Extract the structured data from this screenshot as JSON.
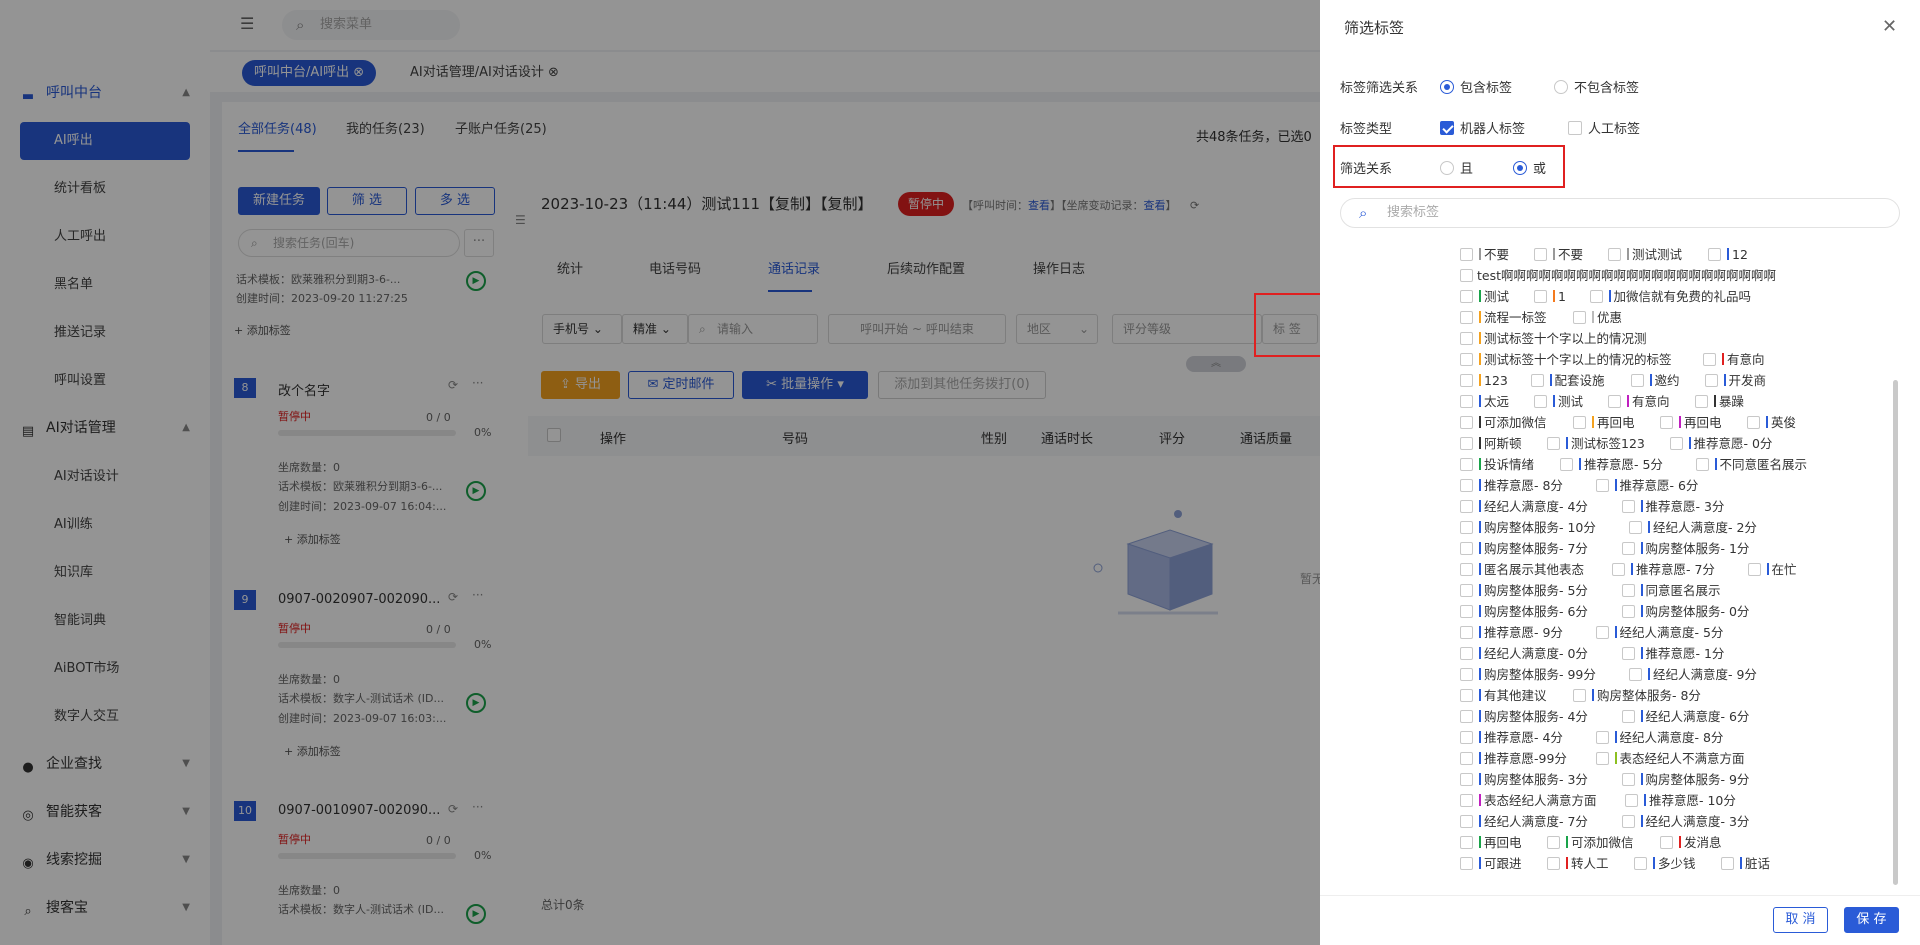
{
  "topbar": {
    "search_placeholder": "搜索菜单"
  },
  "open_tabs": [
    {
      "label": "呼叫中台/AI呼出"
    },
    {
      "label": "AI对话管理/AI对话设计"
    }
  ],
  "sidebar": {
    "sections": [
      {
        "label": "呼叫中台",
        "icon": "monitor-icon"
      },
      {
        "label": "AI对话管理",
        "icon": "dialog-icon"
      },
      {
        "label": "企业查找",
        "icon": "bulb-icon"
      },
      {
        "label": "智能获客",
        "icon": "magnifier-icon"
      },
      {
        "label": "线索挖掘",
        "icon": "target-icon"
      },
      {
        "label": "搜客宝",
        "icon": "search-icon"
      }
    ],
    "call_items": [
      {
        "label": "AI呼出"
      },
      {
        "label": "统计看板"
      },
      {
        "label": "人工呼出"
      },
      {
        "label": "黑名单"
      },
      {
        "label": "推送记录"
      },
      {
        "label": "呼叫设置"
      }
    ],
    "ai_items": [
      {
        "label": "AI对话设计"
      },
      {
        "label": "AI训练"
      },
      {
        "label": "知识库"
      },
      {
        "label": "智能词典"
      },
      {
        "label": "AiBOT市场"
      },
      {
        "label": "数字人交互"
      }
    ]
  },
  "main": {
    "task_tabs": [
      {
        "label": "全部任务(48)"
      },
      {
        "label": "我的任务(23)"
      },
      {
        "label": "子账户任务(25)"
      }
    ],
    "summary": "共48条任务，已选0",
    "buttons": {
      "new_task": "新建任务",
      "filter": "筛 选",
      "multi": "多 选"
    },
    "task_search_placeholder": "搜索任务(回车)",
    "more": "···",
    "task_top": {
      "template": "话术模板：欧莱雅积分到期3-6-...",
      "created": "创建时间：2023-09-20 11:27:25",
      "add_tag": "+ 添加标签"
    },
    "tasks": [
      {
        "num": "8",
        "name": "改个名字",
        "status": "暂停中",
        "count": "0 / 0",
        "pct": "0%",
        "seats": "坐席数量：0",
        "template": "话术模板：欧莱雅积分到期3-6-...",
        "created": "创建时间：2023-09-07 16:04:...",
        "add_tag": "+ 添加标签"
      },
      {
        "num": "9",
        "name": "0907-0020907-002090...",
        "status": "暂停中",
        "count": "0 / 0",
        "pct": "0%",
        "seats": "坐席数量：0",
        "template": "话术模板：数字人-测试话术 (ID...",
        "created": "创建时间：2023-09-07 16:03:...",
        "add_tag": "+ 添加标签"
      },
      {
        "num": "10",
        "name": "0907-0010907-002090...",
        "status": "暂停中",
        "count": "0 / 0",
        "pct": "0%",
        "seats": "坐席数量：0",
        "template": "话术模板：数字人-测试话术 (ID..."
      }
    ],
    "detail": {
      "title": "2023-10-23（11:44）测试111【复制】【复制】",
      "status": "暂停中",
      "call_time_label": "【呼叫时间：",
      "view1": "查看",
      "seat_log_label": "】【坐席变动记录：",
      "view2": "查看",
      "close_bracket": "】",
      "tabs": [
        {
          "label": "统计"
        },
        {
          "label": "电话号码"
        },
        {
          "label": "通话记录"
        },
        {
          "label": "后续动作配置"
        },
        {
          "label": "操作日志"
        }
      ],
      "filters": {
        "phone": "手机号",
        "exact": "精准",
        "input_placeholder": "请输入",
        "call_range": "呼叫开始 ~ 呼叫结束",
        "region": "地区",
        "score": "评分等级",
        "tag": "标 签"
      },
      "actions": {
        "export": "导出",
        "email": "定时邮件",
        "batch": "批量操作",
        "dial_other": "添加到其他任务拨打(0)"
      },
      "columns": [
        {
          "label": "操作"
        },
        {
          "label": "号码"
        },
        {
          "label": "性别"
        },
        {
          "label": "通话时长"
        },
        {
          "label": "评分"
        },
        {
          "label": "通话质量"
        }
      ],
      "empty_text": "暂无",
      "total": "总计0条"
    }
  },
  "drawer": {
    "title": "筛选标签",
    "row1": {
      "label": "标签筛选关系",
      "opt1": "包含标签",
      "opt2": "不包含标签"
    },
    "row2": {
      "label": "标签类型",
      "opt1": "机器人标签",
      "opt2": "人工标签"
    },
    "row3": {
      "label": "筛选关系",
      "opt1": "且",
      "opt2": "或"
    },
    "search_placeholder": "搜索标签",
    "cancel": "取 消",
    "save": "保 存",
    "tags": [
      [
        {
          "t": "不要",
          "c": "#999999"
        },
        {
          "t": "不要",
          "c": "#999999"
        },
        {
          "t": "测试测试",
          "c": "#999999"
        },
        {
          "t": "12",
          "c": "#2a5bd7"
        }
      ],
      [
        {
          "t": "test啊啊啊啊啊啊啊啊啊啊啊啊啊啊啊啊啊啊啊啊啊啊",
          "c": ""
        }
      ],
      [
        {
          "t": "测试",
          "c": "#1aa34a"
        },
        {
          "t": "1",
          "c": "#f47a1f"
        },
        {
          "t": "加微信就有免费的礼品吗",
          "c": "#2a5bd7"
        }
      ],
      [
        {
          "t": "流程一标签",
          "c": "#f4a21f"
        },
        {
          "t": "优惠",
          "c": "#bbbbbb"
        }
      ],
      [
        {
          "t": "测试标签十个字以上的情况测",
          "c": "#f4a21f"
        }
      ],
      [
        {
          "t": "测试标签十个字以上的情况的标签",
          "c": "#f4a21f"
        },
        {
          "t": "有意向",
          "c": "#e02020"
        }
      ],
      [
        {
          "t": "123",
          "c": "#f4a21f"
        },
        {
          "t": "配套设施",
          "c": "#2a5bd7"
        },
        {
          "t": "邀约",
          "c": "#2a5bd7"
        },
        {
          "t": "开发商",
          "c": "#2a5bd7"
        }
      ],
      [
        {
          "t": "太远",
          "c": "#2a5bd7"
        },
        {
          "t": "测试",
          "c": "#2a5bd7"
        },
        {
          "t": "有意向",
          "c": "#c020c0"
        },
        {
          "t": "暴躁",
          "c": "#333333"
        }
      ],
      [
        {
          "t": "可添加微信",
          "c": "#333333"
        },
        {
          "t": "再回电",
          "c": "#f4a21f"
        },
        {
          "t": "再回电",
          "c": "#c020c0"
        },
        {
          "t": "英俊",
          "c": "#2a5bd7"
        }
      ],
      [
        {
          "t": "阿斯顿",
          "c": "#333333"
        },
        {
          "t": "测试标签123",
          "c": "#2a5bd7"
        },
        {
          "t": "推荐意愿- 0分",
          "c": "#2a5bd7"
        }
      ],
      [
        {
          "t": "投诉情绪",
          "c": "#1aa34a"
        },
        {
          "t": "推荐意愿- 5分",
          "c": "#2a5bd7"
        },
        {
          "t": "不同意匿名展示",
          "c": "#2a5bd7"
        }
      ],
      [
        {
          "t": "推荐意愿- 8分",
          "c": "#2a5bd7"
        },
        {
          "t": "推荐意愿- 6分",
          "c": "#2a5bd7"
        }
      ],
      [
        {
          "t": "经纪人满意度- 4分",
          "c": "#2a5bd7"
        },
        {
          "t": "推荐意愿- 3分",
          "c": "#2a5bd7"
        }
      ],
      [
        {
          "t": "购房整体服务- 10分",
          "c": "#2a5bd7"
        },
        {
          "t": "经纪人满意度- 2分",
          "c": "#2a5bd7"
        }
      ],
      [
        {
          "t": "购房整体服务- 7分",
          "c": "#2a5bd7"
        },
        {
          "t": "购房整体服务- 1分",
          "c": "#2a5bd7"
        }
      ],
      [
        {
          "t": "匿名展示其他表态",
          "c": "#2a5bd7"
        },
        {
          "t": "推荐意愿- 7分",
          "c": "#2a5bd7"
        },
        {
          "t": "在忙",
          "c": "#2a5bd7"
        }
      ],
      [
        {
          "t": "购房整体服务- 5分",
          "c": "#2a5bd7"
        },
        {
          "t": "同意匿名展示",
          "c": "#2a5bd7"
        }
      ],
      [
        {
          "t": "购房整体服务- 6分",
          "c": "#2a5bd7"
        },
        {
          "t": "购房整体服务- 0分",
          "c": "#2a5bd7"
        }
      ],
      [
        {
          "t": "推荐意愿- 9分",
          "c": "#2a5bd7"
        },
        {
          "t": "经纪人满意度- 5分",
          "c": "#2a5bd7"
        }
      ],
      [
        {
          "t": "经纪人满意度- 0分",
          "c": "#2a5bd7"
        },
        {
          "t": "推荐意愿- 1分",
          "c": "#2a5bd7"
        }
      ],
      [
        {
          "t": "购房整体服务- 99分",
          "c": "#2a5bd7"
        },
        {
          "t": "经纪人满意度- 9分",
          "c": "#2a5bd7"
        }
      ],
      [
        {
          "t": "有其他建议",
          "c": "#2a5bd7"
        },
        {
          "t": "购房整体服务- 8分",
          "c": "#2a5bd7"
        }
      ],
      [
        {
          "t": "购房整体服务- 4分",
          "c": "#2a5bd7"
        },
        {
          "t": "经纪人满意度- 6分",
          "c": "#2a5bd7"
        }
      ],
      [
        {
          "t": "推荐意愿- 4分",
          "c": "#2a5bd7"
        },
        {
          "t": "经纪人满意度- 8分",
          "c": "#2a5bd7"
        }
      ],
      [
        {
          "t": "推荐意愿-99分",
          "c": "#2a5bd7"
        },
        {
          "t": "表态经纪人不满意方面",
          "c": "#8cc020"
        }
      ],
      [
        {
          "t": "购房整体服务- 3分",
          "c": "#2a5bd7"
        },
        {
          "t": "购房整体服务- 9分",
          "c": "#2a5bd7"
        }
      ],
      [
        {
          "t": "表态经纪人满意方面",
          "c": "#c020c0"
        },
        {
          "t": "推荐意愿- 10分",
          "c": "#2a5bd7"
        }
      ],
      [
        {
          "t": "经纪人满意度- 7分",
          "c": "#2a5bd7"
        },
        {
          "t": "经纪人满意度- 3分",
          "c": "#2a5bd7"
        }
      ],
      [
        {
          "t": "再回电",
          "c": "#1aa34a"
        },
        {
          "t": "可添加微信",
          "c": "#1aa34a"
        },
        {
          "t": "发消息",
          "c": "#e02020"
        }
      ],
      [
        {
          "t": "可跟进",
          "c": "#2a5bd7"
        },
        {
          "t": "转人工",
          "c": "#e02020"
        },
        {
          "t": "多少钱",
          "c": "#2a5bd7"
        },
        {
          "t": "脏话",
          "c": "#2a5bd7"
        }
      ]
    ]
  }
}
